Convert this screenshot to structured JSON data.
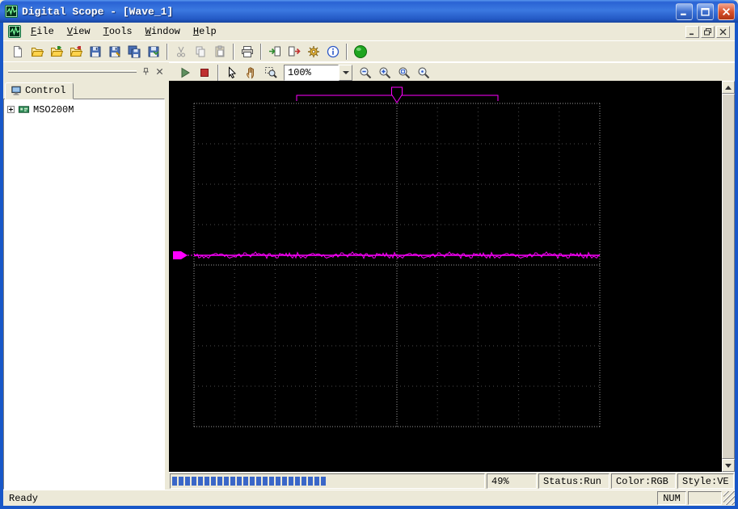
{
  "window": {
    "title": "Digital Scope - [Wave_1]"
  },
  "menu": {
    "items": [
      {
        "label": "File"
      },
      {
        "label": "View"
      },
      {
        "label": "Tools"
      },
      {
        "label": "Window"
      },
      {
        "label": "Help"
      }
    ]
  },
  "toolbar_main": {
    "buttons": [
      "new-file",
      "open-file",
      "load-setup",
      "recall-waveform",
      "save",
      "save-as",
      "save-all",
      "save-data",
      "cut",
      "copy",
      "paste",
      "print",
      "import-data",
      "export-data",
      "settings",
      "about",
      "acquire"
    ]
  },
  "toolbar_view": {
    "zoom_value": "100%",
    "buttons": [
      "run",
      "stop",
      "select-cursor",
      "pan-hand",
      "zoom-window",
      "zoom-out",
      "zoom-in",
      "zoom-fit",
      "zoom-all"
    ]
  },
  "sidebar": {
    "tab_label": "Control",
    "tree": [
      {
        "label": "MSO200M",
        "expanded": false
      }
    ]
  },
  "scope": {
    "progress_percent": 49,
    "progress_label": "49%",
    "status_label": "Status:Run",
    "color_label": "Color:RGB",
    "style_label": "Style:VE",
    "grid": {
      "cols": 10,
      "rows": 8
    },
    "waveform_color": "#FF00FF",
    "background": "#000000"
  },
  "statusbar": {
    "message": "Ready",
    "num_label": "NUM"
  }
}
